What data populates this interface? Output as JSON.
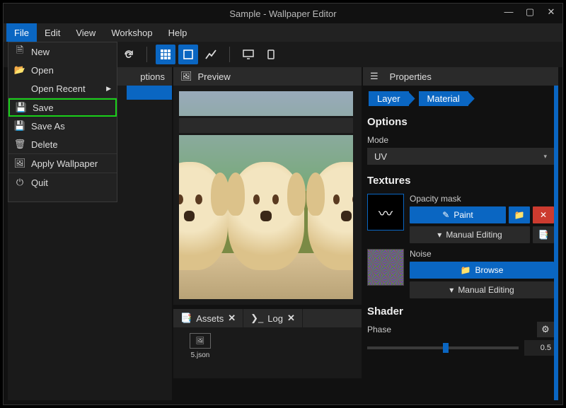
{
  "title": "Sample - Wallpaper Editor",
  "menubar": [
    "File",
    "Edit",
    "View",
    "Workshop",
    "Help"
  ],
  "file_menu": {
    "new": "New",
    "open": "Open",
    "open_recent": "Open Recent",
    "save": "Save",
    "save_as": "Save As",
    "delete": "Delete",
    "apply": "Apply Wallpaper",
    "quit": "Quit"
  },
  "left": {
    "layer_options": "ptions"
  },
  "preview": {
    "header": "Preview"
  },
  "tabs": {
    "assets": "Assets",
    "log": "Log"
  },
  "asset": {
    "file": "5.json"
  },
  "properties": {
    "header": "Properties",
    "crumb_layer": "Layer",
    "crumb_material": "Material",
    "options_title": "Options",
    "mode_label": "Mode",
    "mode_value": "UV",
    "textures_title": "Textures",
    "opacity_label": "Opacity mask",
    "paint": "Paint",
    "manual_editing": "Manual Editing",
    "noise_label": "Noise",
    "browse": "Browse",
    "shader_title": "Shader",
    "phase_label": "Phase",
    "phase_value": "0.5"
  }
}
